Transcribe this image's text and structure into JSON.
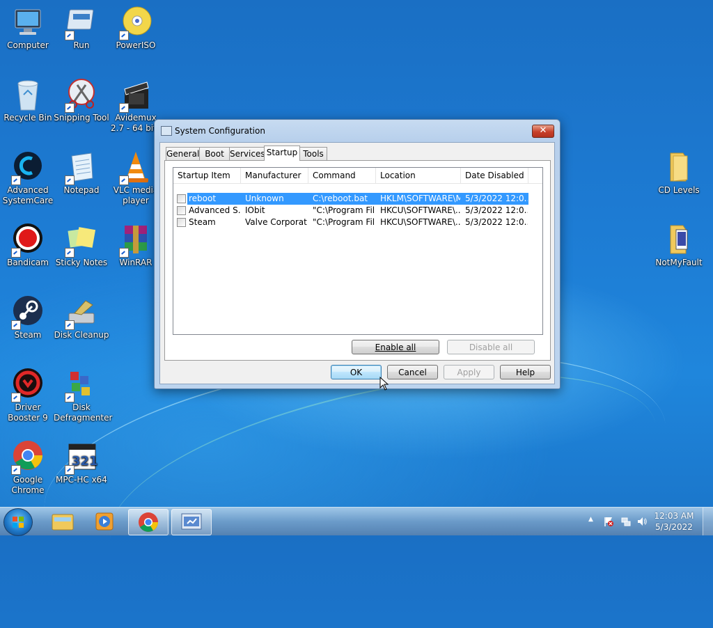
{
  "desktop_icons": [
    {
      "label": "Computer",
      "icon": "computer-icon"
    },
    {
      "label": "Run",
      "icon": "run-icon"
    },
    {
      "label": "PowerISO",
      "icon": "poweriso-icon"
    },
    {
      "label": "Recycle Bin",
      "icon": "recycle-bin-icon"
    },
    {
      "label": "Snipping Tool",
      "icon": "snipping-tool-icon"
    },
    {
      "label": "Avidemux 2.7 - 64 bits",
      "icon": "avidemux-icon"
    },
    {
      "label": "Advanced SystemCare",
      "icon": "advanced-systemcare-icon"
    },
    {
      "label": "Notepad",
      "icon": "notepad-icon"
    },
    {
      "label": "VLC media player",
      "icon": "vlc-icon"
    },
    {
      "label": "Bandicam",
      "icon": "bandicam-icon"
    },
    {
      "label": "Sticky Notes",
      "icon": "sticky-notes-icon"
    },
    {
      "label": "WinRAR",
      "icon": "winrar-icon"
    },
    {
      "label": "Steam",
      "icon": "steam-icon"
    },
    {
      "label": "Disk Cleanup",
      "icon": "disk-cleanup-icon"
    },
    {
      "label": "Driver Booster 9",
      "icon": "driver-booster-icon"
    },
    {
      "label": "Disk Defragmenter",
      "icon": "disk-defragmenter-icon"
    },
    {
      "label": "Google Chrome",
      "icon": "chrome-icon"
    },
    {
      "label": "MPC-HC x64",
      "icon": "mpc-hc-icon"
    },
    {
      "label": "CD Levels",
      "icon": "folder-icon"
    },
    {
      "label": "NotMyFault",
      "icon": "folder-icon"
    }
  ],
  "dialog": {
    "title": "System Configuration",
    "close": "✕",
    "tabs": [
      "General",
      "Boot",
      "Services",
      "Startup",
      "Tools"
    ],
    "active_tab": "Startup",
    "columns": [
      "Startup Item",
      "Manufacturer",
      "Command",
      "Location",
      "Date Disabled"
    ],
    "rows": [
      {
        "item": "reboot",
        "manufacturer": "Unknown",
        "command": "C:\\reboot.bat",
        "location": "HKLM\\SOFTWARE\\M...",
        "date": "5/3/2022 12:0...",
        "checked": false,
        "selected": true
      },
      {
        "item": "Advanced S...",
        "manufacturer": "IObit",
        "command": "\"C:\\Program Fil...",
        "location": "HKCU\\SOFTWARE\\...",
        "date": "5/3/2022 12:0...",
        "checked": false,
        "selected": false
      },
      {
        "item": "Steam",
        "manufacturer": "Valve Corporat...",
        "command": "\"C:\\Program Fil...",
        "location": "HKCU\\SOFTWARE\\...",
        "date": "5/3/2022 12:0...",
        "checked": false,
        "selected": false
      }
    ],
    "enable_all": "Enable all",
    "disable_all": "Disable all",
    "ok": "OK",
    "cancel": "Cancel",
    "apply": "Apply",
    "help": "Help"
  },
  "taskbar": {
    "pinned": [
      "windows-explorer-icon",
      "media-player-icon",
      "chrome-icon",
      "system-configuration-icon"
    ],
    "tray": {
      "time": "12:03 AM",
      "date": "5/3/2022",
      "show_hidden": "▲"
    }
  }
}
